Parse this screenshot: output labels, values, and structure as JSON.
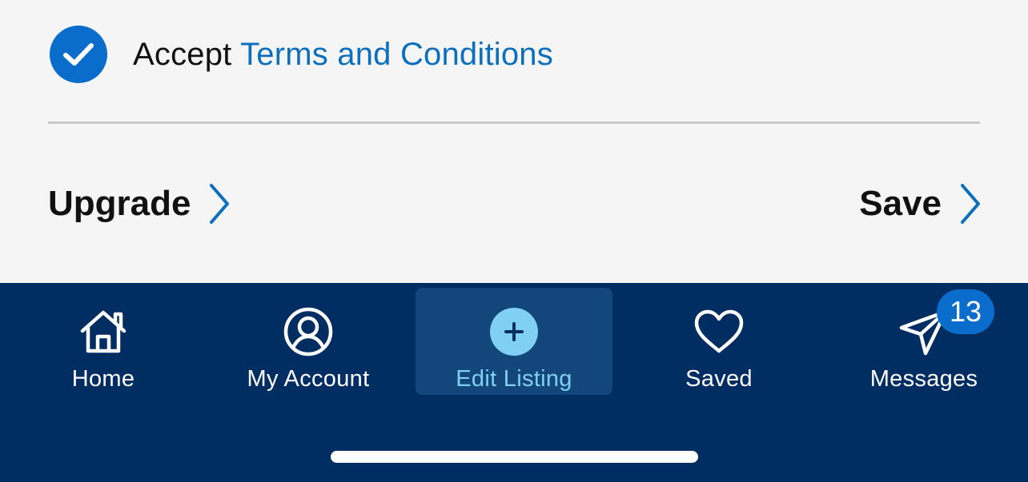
{
  "terms": {
    "checked": true,
    "prefix": "Accept",
    "link_text": "Terms and Conditions"
  },
  "actions": {
    "upgrade_label": "Upgrade",
    "save_label": "Save"
  },
  "tabbar": {
    "active": "Edit Listing",
    "items": [
      {
        "label": "Home",
        "icon": "home-icon"
      },
      {
        "label": "My Account",
        "icon": "user-circle-icon"
      },
      {
        "label": "Edit Listing",
        "icon": "plus-circle-icon"
      },
      {
        "label": "Saved",
        "icon": "heart-icon"
      },
      {
        "label": "Messages",
        "icon": "paper-plane-icon"
      }
    ],
    "messages_badge": "13"
  },
  "colors": {
    "accent_blue": "#0a6dcc",
    "link_blue": "#0b6fbd",
    "tabbar_bg": "#002d62",
    "active_tab_bg": "#13467b",
    "active_tab_text": "#7fd0f2",
    "page_bg": "#f5f5f5"
  }
}
